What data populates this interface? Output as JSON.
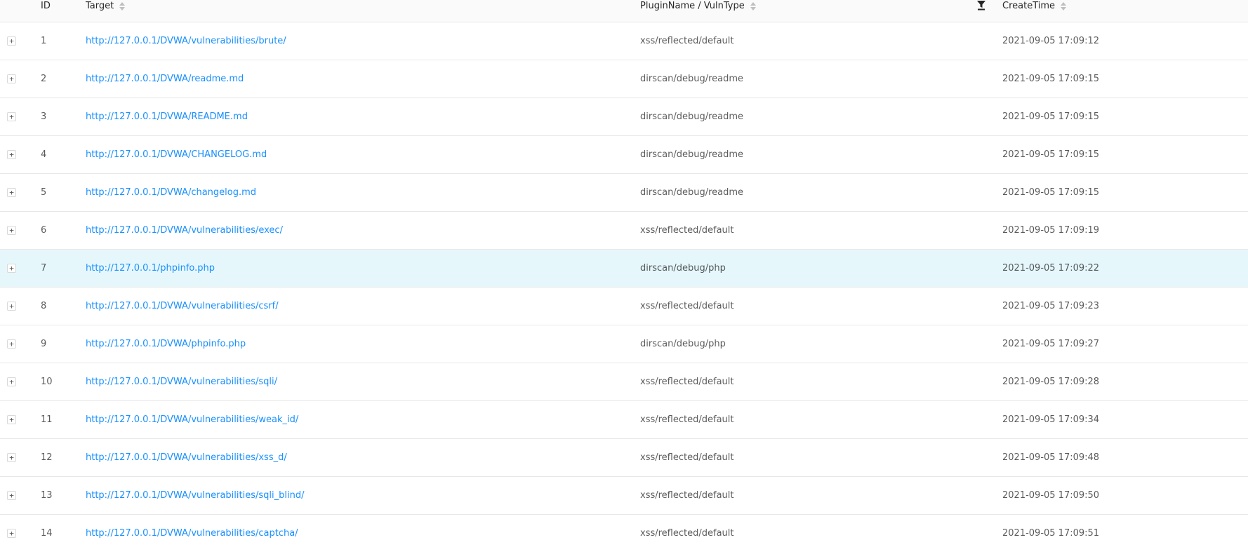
{
  "table": {
    "columns": {
      "id": "ID",
      "target": "Target",
      "plugin": "PluginName / VulnType",
      "time": "CreateTime"
    },
    "expand_symbol": "+",
    "rows": [
      {
        "id": "1",
        "target": "http://127.0.0.1/DVWA/vulnerabilities/brute/",
        "plugin": "xss/reflected/default",
        "time": "2021-09-05 17:09:12"
      },
      {
        "id": "2",
        "target": "http://127.0.0.1/DVWA/readme.md",
        "plugin": "dirscan/debug/readme",
        "time": "2021-09-05 17:09:15"
      },
      {
        "id": "3",
        "target": "http://127.0.0.1/DVWA/README.md",
        "plugin": "dirscan/debug/readme",
        "time": "2021-09-05 17:09:15"
      },
      {
        "id": "4",
        "target": "http://127.0.0.1/DVWA/CHANGELOG.md",
        "plugin": "dirscan/debug/readme",
        "time": "2021-09-05 17:09:15"
      },
      {
        "id": "5",
        "target": "http://127.0.0.1/DVWA/changelog.md",
        "plugin": "dirscan/debug/readme",
        "time": "2021-09-05 17:09:15"
      },
      {
        "id": "6",
        "target": "http://127.0.0.1/DVWA/vulnerabilities/exec/",
        "plugin": "xss/reflected/default",
        "time": "2021-09-05 17:09:19"
      },
      {
        "id": "7",
        "target": "http://127.0.0.1/phpinfo.php",
        "plugin": "dirscan/debug/php",
        "time": "2021-09-05 17:09:22"
      },
      {
        "id": "8",
        "target": "http://127.0.0.1/DVWA/vulnerabilities/csrf/",
        "plugin": "xss/reflected/default",
        "time": "2021-09-05 17:09:23"
      },
      {
        "id": "9",
        "target": "http://127.0.0.1/DVWA/phpinfo.php",
        "plugin": "dirscan/debug/php",
        "time": "2021-09-05 17:09:27"
      },
      {
        "id": "10",
        "target": "http://127.0.0.1/DVWA/vulnerabilities/sqli/",
        "plugin": "xss/reflected/default",
        "time": "2021-09-05 17:09:28"
      },
      {
        "id": "11",
        "target": "http://127.0.0.1/DVWA/vulnerabilities/weak_id/",
        "plugin": "xss/reflected/default",
        "time": "2021-09-05 17:09:34"
      },
      {
        "id": "12",
        "target": "http://127.0.0.1/DVWA/vulnerabilities/xss_d/",
        "plugin": "xss/reflected/default",
        "time": "2021-09-05 17:09:48"
      },
      {
        "id": "13",
        "target": "http://127.0.0.1/DVWA/vulnerabilities/sqli_blind/",
        "plugin": "xss/reflected/default",
        "time": "2021-09-05 17:09:50"
      },
      {
        "id": "14",
        "target": "http://127.0.0.1/DVWA/vulnerabilities/captcha/",
        "plugin": "xss/reflected/default",
        "time": "2021-09-05 17:09:51"
      }
    ],
    "highlighted_row_id": "7"
  },
  "colors": {
    "link": "#1890ff",
    "highlight_row": "#e6f7fc",
    "border": "#e8e8e8"
  },
  "icons": {
    "sort": "sort-caret-icon",
    "filter": "filter-icon",
    "expand": "plus-icon"
  }
}
